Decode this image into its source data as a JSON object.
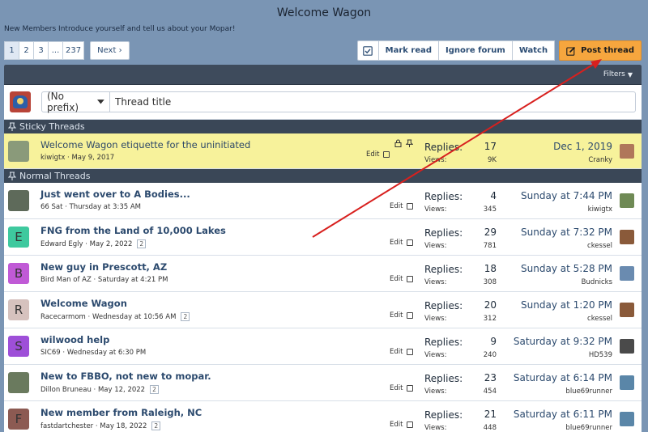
{
  "header": {
    "title": "Welcome Wagon",
    "description": "New Members Introduce yourself and tell us about your Mopar!"
  },
  "pagination": {
    "pages": [
      "1",
      "2",
      "3",
      "...",
      "237"
    ],
    "current": "1",
    "next_label": "Next ›"
  },
  "actions": {
    "mark_read": "Mark read",
    "ignore_forum": "Ignore forum",
    "watch": "Watch",
    "post_thread": "Post thread"
  },
  "filters_label": "Filters",
  "quick_thread": {
    "prefix": "(No prefix)",
    "title_placeholder": "Thread title"
  },
  "sections": {
    "sticky": "Sticky Threads",
    "normal": "Normal Threads"
  },
  "labels": {
    "replies": "Replies:",
    "views": "Views:",
    "edit": "Edit"
  },
  "sticky_threads": [
    {
      "title": "Welcome Wagon etiquette for the uninitiated",
      "author": "kiwigtx",
      "date": "May 9, 2017",
      "replies": "17",
      "views": "9K",
      "last_date": "Dec 1, 2019",
      "last_user": "Cranky",
      "avatar_color": "#8a9a7a",
      "last_avatar_color": "#b0775a"
    }
  ],
  "threads": [
    {
      "title": "Just went over to A Bodies...",
      "author": "66 Sat",
      "date": "Thursday at 3:35 AM",
      "pages": "",
      "replies": "4",
      "views": "345",
      "last_date": "Sunday at 7:44 PM",
      "last_user": "kiwigtx",
      "avatar_letter": "",
      "avatar_color": "#5e6a5a",
      "last_avatar_color": "#6f8a55"
    },
    {
      "title": "FNG from the Land of 10,000 Lakes",
      "author": "Edward Egly",
      "date": "May 2, 2022",
      "pages": "2",
      "replies": "29",
      "views": "781",
      "last_date": "Sunday at 7:32 PM",
      "last_user": "ckessel",
      "avatar_letter": "E",
      "avatar_color": "#3ec99e",
      "last_avatar_color": "#8a5a3a"
    },
    {
      "title": "New guy in Prescott, AZ",
      "author": "Bird Man of AZ",
      "date": "Saturday at 4:21 PM",
      "pages": "",
      "replies": "18",
      "views": "308",
      "last_date": "Sunday at 5:28 PM",
      "last_user": "Budnicks",
      "avatar_letter": "B",
      "avatar_color": "#c05ad6",
      "last_avatar_color": "#6a8bb0"
    },
    {
      "title": "Welcome Wagon",
      "author": "Racecarmom",
      "date": "Wednesday at 10:56 AM",
      "pages": "2",
      "replies": "20",
      "views": "312",
      "last_date": "Sunday at 1:20 PM",
      "last_user": "ckessel",
      "avatar_letter": "R",
      "avatar_color": "#d6c2be",
      "last_avatar_color": "#8a5a3a"
    },
    {
      "title": "wilwood help",
      "author": "SIC69",
      "date": "Wednesday at 6:30 PM",
      "pages": "",
      "replies": "9",
      "views": "240",
      "last_date": "Saturday at 9:32 PM",
      "last_user": "HD539",
      "avatar_letter": "S",
      "avatar_color": "#9e4fd8",
      "last_avatar_color": "#4a4a4a"
    },
    {
      "title": "New to FBBO, not new to mopar.",
      "author": "Dillon Bruneau",
      "date": "May 12, 2022",
      "pages": "2",
      "replies": "23",
      "views": "454",
      "last_date": "Saturday at 6:14 PM",
      "last_user": "blue69runner",
      "avatar_letter": "",
      "avatar_color": "#6a7a5e",
      "last_avatar_color": "#5a86a8"
    },
    {
      "title": "New member from Raleigh, NC",
      "author": "fastdartchester",
      "date": "May 18, 2022",
      "pages": "2",
      "replies": "21",
      "views": "448",
      "last_date": "Saturday at 6:11 PM",
      "last_user": "blue69runner",
      "avatar_letter": "F",
      "avatar_color": "#8c5a52",
      "last_avatar_color": "#5a86a8"
    }
  ]
}
